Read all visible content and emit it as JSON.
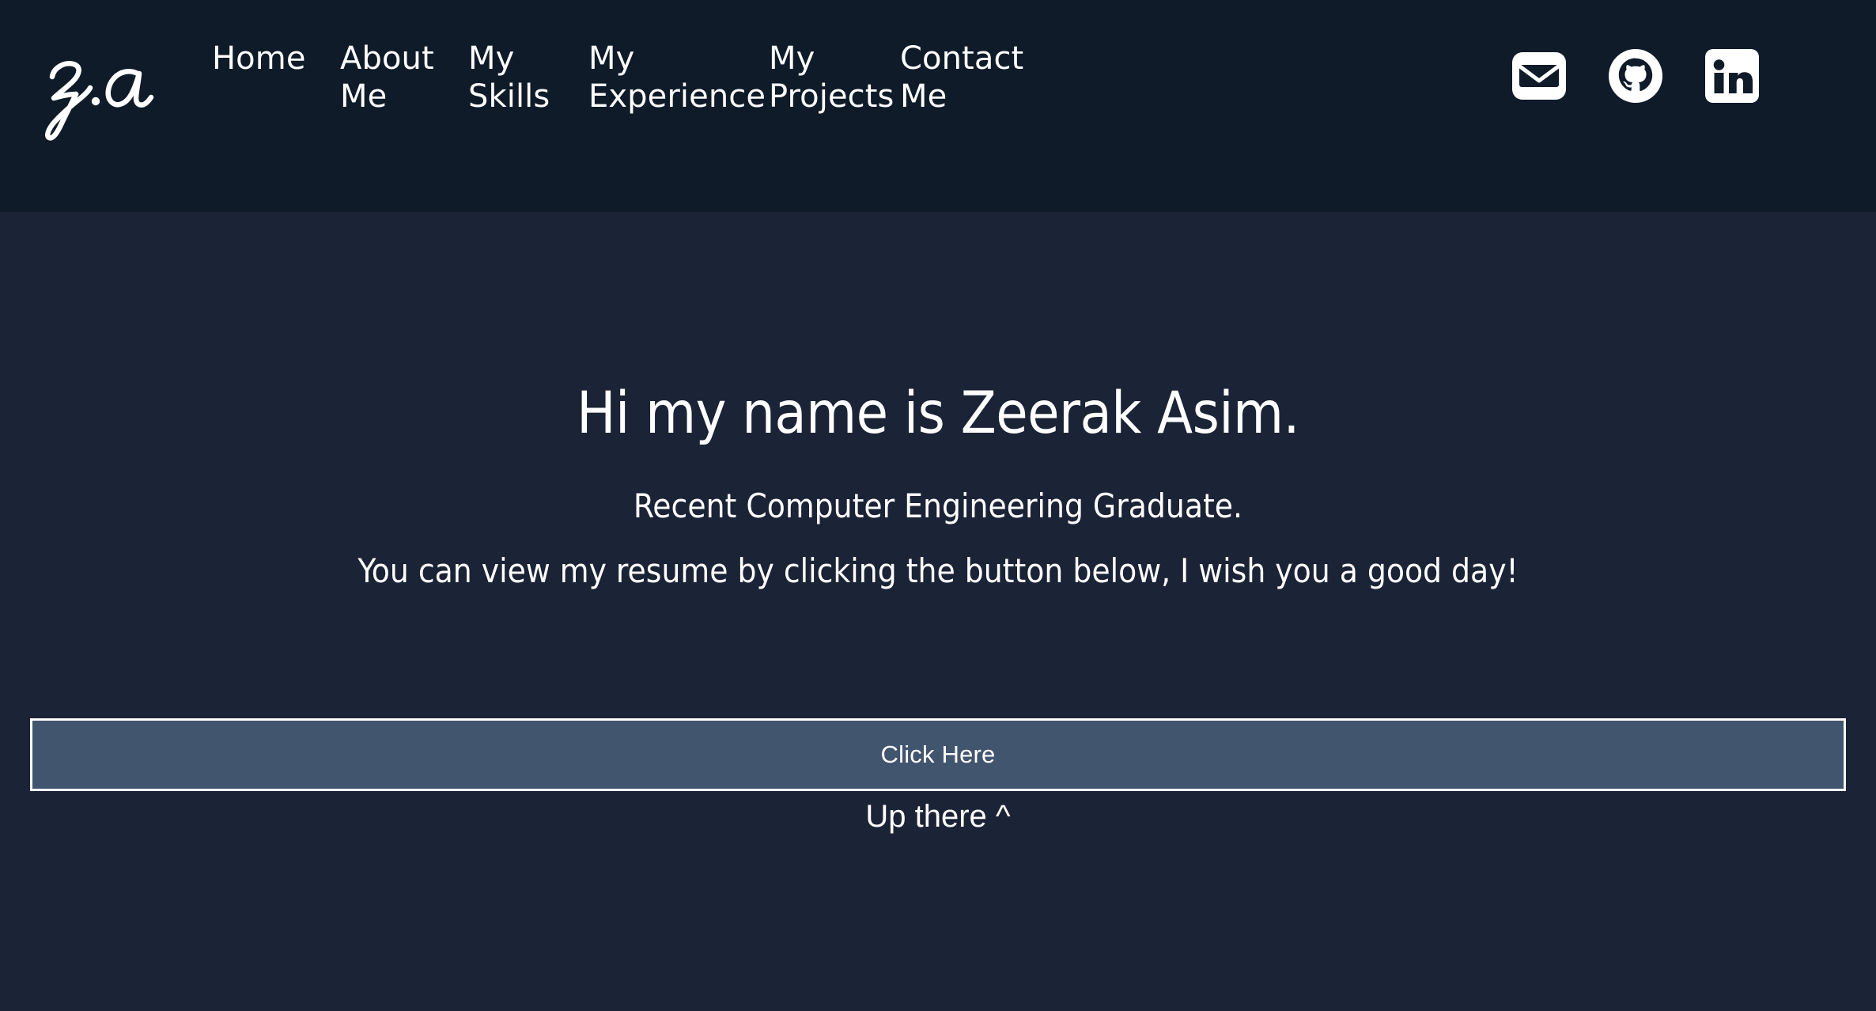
{
  "colors": {
    "header_bg": "#0f1b29",
    "body_bg": "#1b2336",
    "button_bg": "#42556e",
    "button_border": "#ffffff",
    "text": "#ffffff"
  },
  "header": {
    "logo_text": "z.a",
    "nav": [
      {
        "label": "Home",
        "icon": "home-link"
      },
      {
        "label": "About Me",
        "icon": "about-link"
      },
      {
        "label": "My Skills",
        "icon": "skills-link"
      },
      {
        "label": "My Experience",
        "icon": "experience-link"
      },
      {
        "label": "My Projects",
        "icon": "projects-link"
      },
      {
        "label": "Contact Me",
        "icon": "contact-link"
      }
    ],
    "social": [
      {
        "name": "email-icon",
        "label": "Email"
      },
      {
        "name": "github-icon",
        "label": "GitHub"
      },
      {
        "name": "linkedin-icon",
        "label": "LinkedIn"
      }
    ]
  },
  "hero": {
    "title": "Hi my name is Zeerak Asim.",
    "subtitle": "Recent Computer Engineering Graduate.",
    "description": "You can view my resume by clicking the button below, I wish you a good day!",
    "cta_label": "Click Here",
    "back_to_top": "Up there ^"
  }
}
